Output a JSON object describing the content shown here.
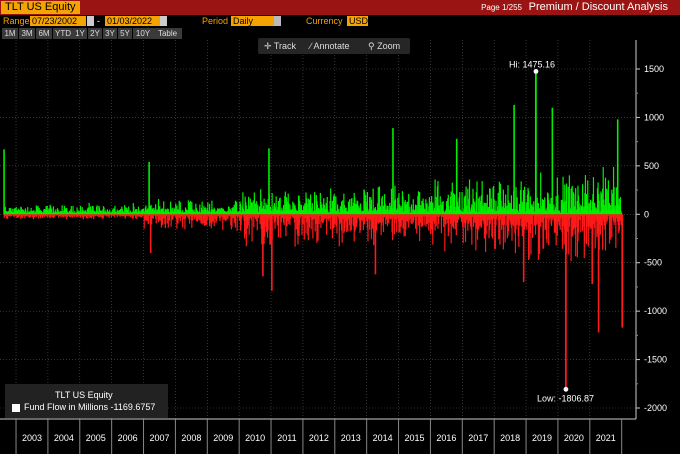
{
  "header": {
    "ticker": "TLT US Equity",
    "page_info": "Page 1/255",
    "screen_title": "Premium / Discount Analysis"
  },
  "toolbar": {
    "range_label": "Range",
    "start_date": "07/23/2002",
    "end_date": "01/03/2022",
    "period_label": "Period",
    "period_value": "Daily",
    "currency_label": "Currency",
    "currency_value": "USD"
  },
  "range_buttons": [
    "1M",
    "3M",
    "6M",
    "YTD",
    "1Y",
    "2Y",
    "3Y",
    "5Y",
    "10Y",
    "Table"
  ],
  "chart_tools": {
    "track": "Track",
    "annotate": "Annotate",
    "zoom": "Zoom"
  },
  "legend": {
    "title": "TLT US Equity",
    "series_label": "Fund Flow in Millions",
    "last_value": "-1169.6757"
  },
  "annotations": {
    "high": "Hi: 1475.16",
    "low": "Low: -1806.87"
  },
  "colors": {
    "positive": "#00ee00",
    "negative": "#ff1a1a",
    "accent": "#f5a300",
    "title_bar": "#9b1414"
  },
  "chart_data": {
    "type": "bar",
    "title": "",
    "series": [
      {
        "name": "Fund Flow in Millions"
      }
    ],
    "ylim": [
      -2100,
      1550
    ],
    "yticks": [
      1500,
      1000,
      500,
      0,
      -500,
      -1000,
      -1500,
      -2000
    ],
    "ytick_labels": [
      "1500",
      "1000",
      "500",
      "0",
      "-500",
      "-1000",
      "-1500",
      "-2000"
    ],
    "xticks": [
      "2003",
      "2004",
      "2005",
      "2006",
      "2007",
      "2008",
      "2009",
      "2010",
      "2011",
      "2012",
      "2013",
      "2014",
      "2015",
      "2016",
      "2017",
      "2018",
      "2019",
      "2020",
      "2021"
    ],
    "x_range": [
      2002.56,
      2022.01
    ],
    "high": {
      "x": 2019.28,
      "value": 1475.16
    },
    "low": {
      "x": 2020.22,
      "value": -1806.87
    },
    "last": {
      "x": 2021.99,
      "value": -1169.68
    },
    "spikes": [
      {
        "x": 2002.6,
        "value": 670
      },
      {
        "x": 2007.15,
        "value": 540
      },
      {
        "x": 2007.2,
        "value": -400
      },
      {
        "x": 2010.72,
        "value": -640
      },
      {
        "x": 2010.91,
        "value": 680
      },
      {
        "x": 2011.0,
        "value": -790
      },
      {
        "x": 2014.8,
        "value": 890
      },
      {
        "x": 2014.25,
        "value": -620
      },
      {
        "x": 2016.8,
        "value": 780
      },
      {
        "x": 2018.6,
        "value": 1130
      },
      {
        "x": 2018.9,
        "value": -700
      },
      {
        "x": 2019.8,
        "value": 1100
      },
      {
        "x": 2021.25,
        "value": -1220
      },
      {
        "x": 2021.85,
        "value": 980
      },
      {
        "x": 2021.05,
        "value": -720
      }
    ]
  }
}
